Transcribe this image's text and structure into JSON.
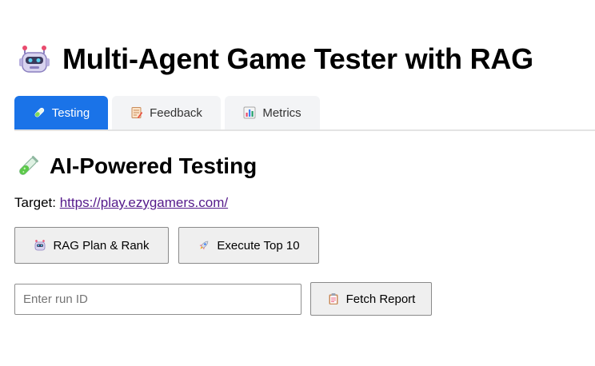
{
  "header": {
    "title": "Multi-Agent Game Tester with RAG",
    "icon": "robot-icon"
  },
  "tabs": [
    {
      "label": "Testing",
      "icon": "test-tube-icon",
      "active": true
    },
    {
      "label": "Feedback",
      "icon": "memo-icon",
      "active": false
    },
    {
      "label": "Metrics",
      "icon": "bar-chart-icon",
      "active": false
    }
  ],
  "section": {
    "title": "AI-Powered Testing",
    "icon": "test-tube-icon"
  },
  "target": {
    "label": "Target:",
    "url": "https://play.ezygamers.com/"
  },
  "actions": {
    "plan_label": "RAG Plan & Rank",
    "execute_label": "Execute Top 10",
    "fetch_label": "Fetch Report"
  },
  "run_input": {
    "placeholder": "Enter run ID",
    "value": ""
  },
  "colors": {
    "accent": "#1a73e8",
    "link": "#551a8b",
    "tab_bg": "#f3f4f6"
  }
}
